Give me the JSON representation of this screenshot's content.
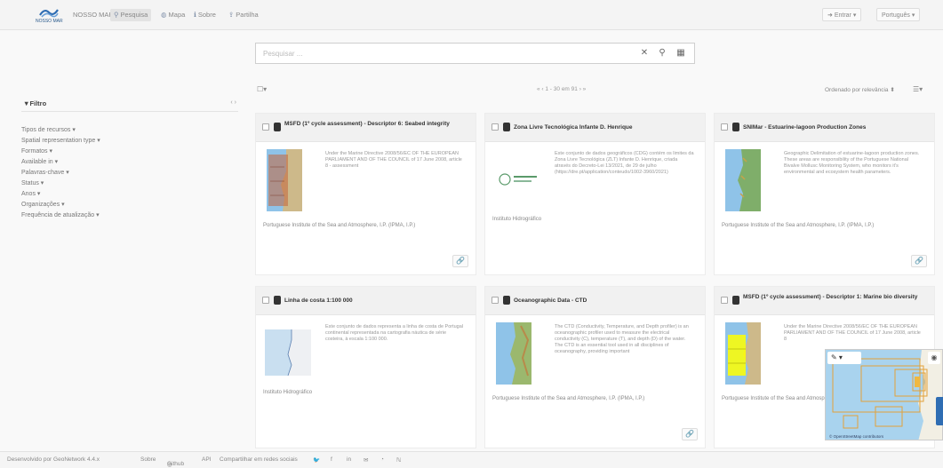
{
  "header": {
    "logo_caption": "NOSSO MAR",
    "brand": "NOSSO MAR",
    "nav": [
      {
        "label": "Pesquisa",
        "icon": "search-icon"
      },
      {
        "label": "Mapa",
        "icon": "globe-icon"
      },
      {
        "label": "Sobre",
        "icon": "info-icon"
      },
      {
        "label": "Partilha",
        "icon": "share-icon"
      }
    ],
    "login_label": "Entrar",
    "language_label": "Português"
  },
  "search": {
    "placeholder": "Pesquisar ...",
    "clear_icon": "close-icon",
    "search_icon": "search-icon",
    "options_icon": "grid-icon"
  },
  "sidebar": {
    "title": "Filtro",
    "collapse_arrows": "‹ ›",
    "facets": [
      "Tipos de recursos",
      "Spatial representation type",
      "Formatos",
      "Available in",
      "Palavras-chave",
      "Status",
      "Anos",
      "Organizações",
      "Frequência de atualização"
    ]
  },
  "results": {
    "pagination": "« ‹ 1 - 30 em 91 › »",
    "sort_label": "Ordenado por relevância",
    "records": [
      {
        "title": "MSFD (1º cycle assessment) - Descriptor 6: Seabed integrity",
        "description": "Under the Marine Directive 2008/56/EC OF THE EUROPEAN PARLIAMENT AND OF THE COUNCIL of 17 June 2008, article 8 - assessment",
        "organisation": "Portuguese Institute of the Sea and Atmosphere, I.P. (IPMA, I.P.)",
        "thumbnail": "map-thumbnail"
      },
      {
        "title": "Zona Livre Tecnológica Infante D. Henrique",
        "description": "Este conjunto de dados geográficos (CDG) contém os limites da Zona Livre Tecnológica (ZLT) Infante D. Henrique, criada através do Decreto-Lei 13/2021, de 29 de julho (https://dre.pt/application/conteudo/1002-3960/2021)",
        "organisation": "Instituto Hidrográfico",
        "thumbnail": "logo-thumbnail"
      },
      {
        "title": "SNIMar - Estuarine-lagoon Production Zones",
        "description": "Geographic Delimitation of estuarine-lagoon production zones. These areas are responsibility of the Portuguese National Bivalve Mollusc Monitoring System, who monitors it's environmental and ecosystem health parameters.",
        "organisation": "Portuguese Institute of the Sea and Atmosphere, I.P. (IPMA, I.P.)",
        "thumbnail": "map-thumbnail"
      },
      {
        "title": "Linha de costa 1:100 000",
        "description": "Este conjunto de dados representa a linha de costa de Portugal continental representada na cartografia náutica de série costeira, à escala 1:100 000.",
        "organisation": "Instituto Hidrográfico",
        "thumbnail": "map-thumbnail"
      },
      {
        "title": "Oceanographic Data - CTD",
        "description": "The CTD (Conductivity, Temperature, and Depth profiler) is an oceanographic profiler used to measure the electrical conductivity (C), temperature (T), and depth (D) of the water. The CTD is an essential tool used in all disciplines of oceanography, providing important",
        "organisation": "Portuguese Institute of the Sea and Atmosphere, I.P. (IPMA, I.P.)",
        "thumbnail": "map-thumbnail"
      },
      {
        "title": "MSFD (1º cycle assessment) - Descriptor 1: Marine bio diversity",
        "description": "Under the Marine Directive 2008/56/EC OF THE EUROPEAN PARLIAMENT AND OF THE COUNCIL of 17 June 2008, article 8",
        "organisation": "Portuguese Institute of the Sea and Atmosphere, I.P. (IPMA, I.P.)",
        "thumbnail": "map-thumbnail"
      }
    ]
  },
  "map_widget": {
    "attribution": "© OpenStreetMap contributors"
  },
  "footer": {
    "developed_by": "Desenvolvido por GeoNetwork 4.4.x",
    "about": "Sobre",
    "github": "Github",
    "api": "API",
    "share_label": "Compartilhar em redes sociais",
    "social_icons": [
      "twitter-icon",
      "facebook-icon",
      "linkedin-icon",
      "email-icon",
      "rss-icon",
      "rss-icon"
    ]
  },
  "colors": {
    "accent": "#2f6db3",
    "header_bg": "#f4f4f4",
    "card_head_bg": "#f1f1f1",
    "map_sea": "#a9d3ee",
    "map_land": "#f2efe4",
    "highlight": "#ffff00"
  }
}
